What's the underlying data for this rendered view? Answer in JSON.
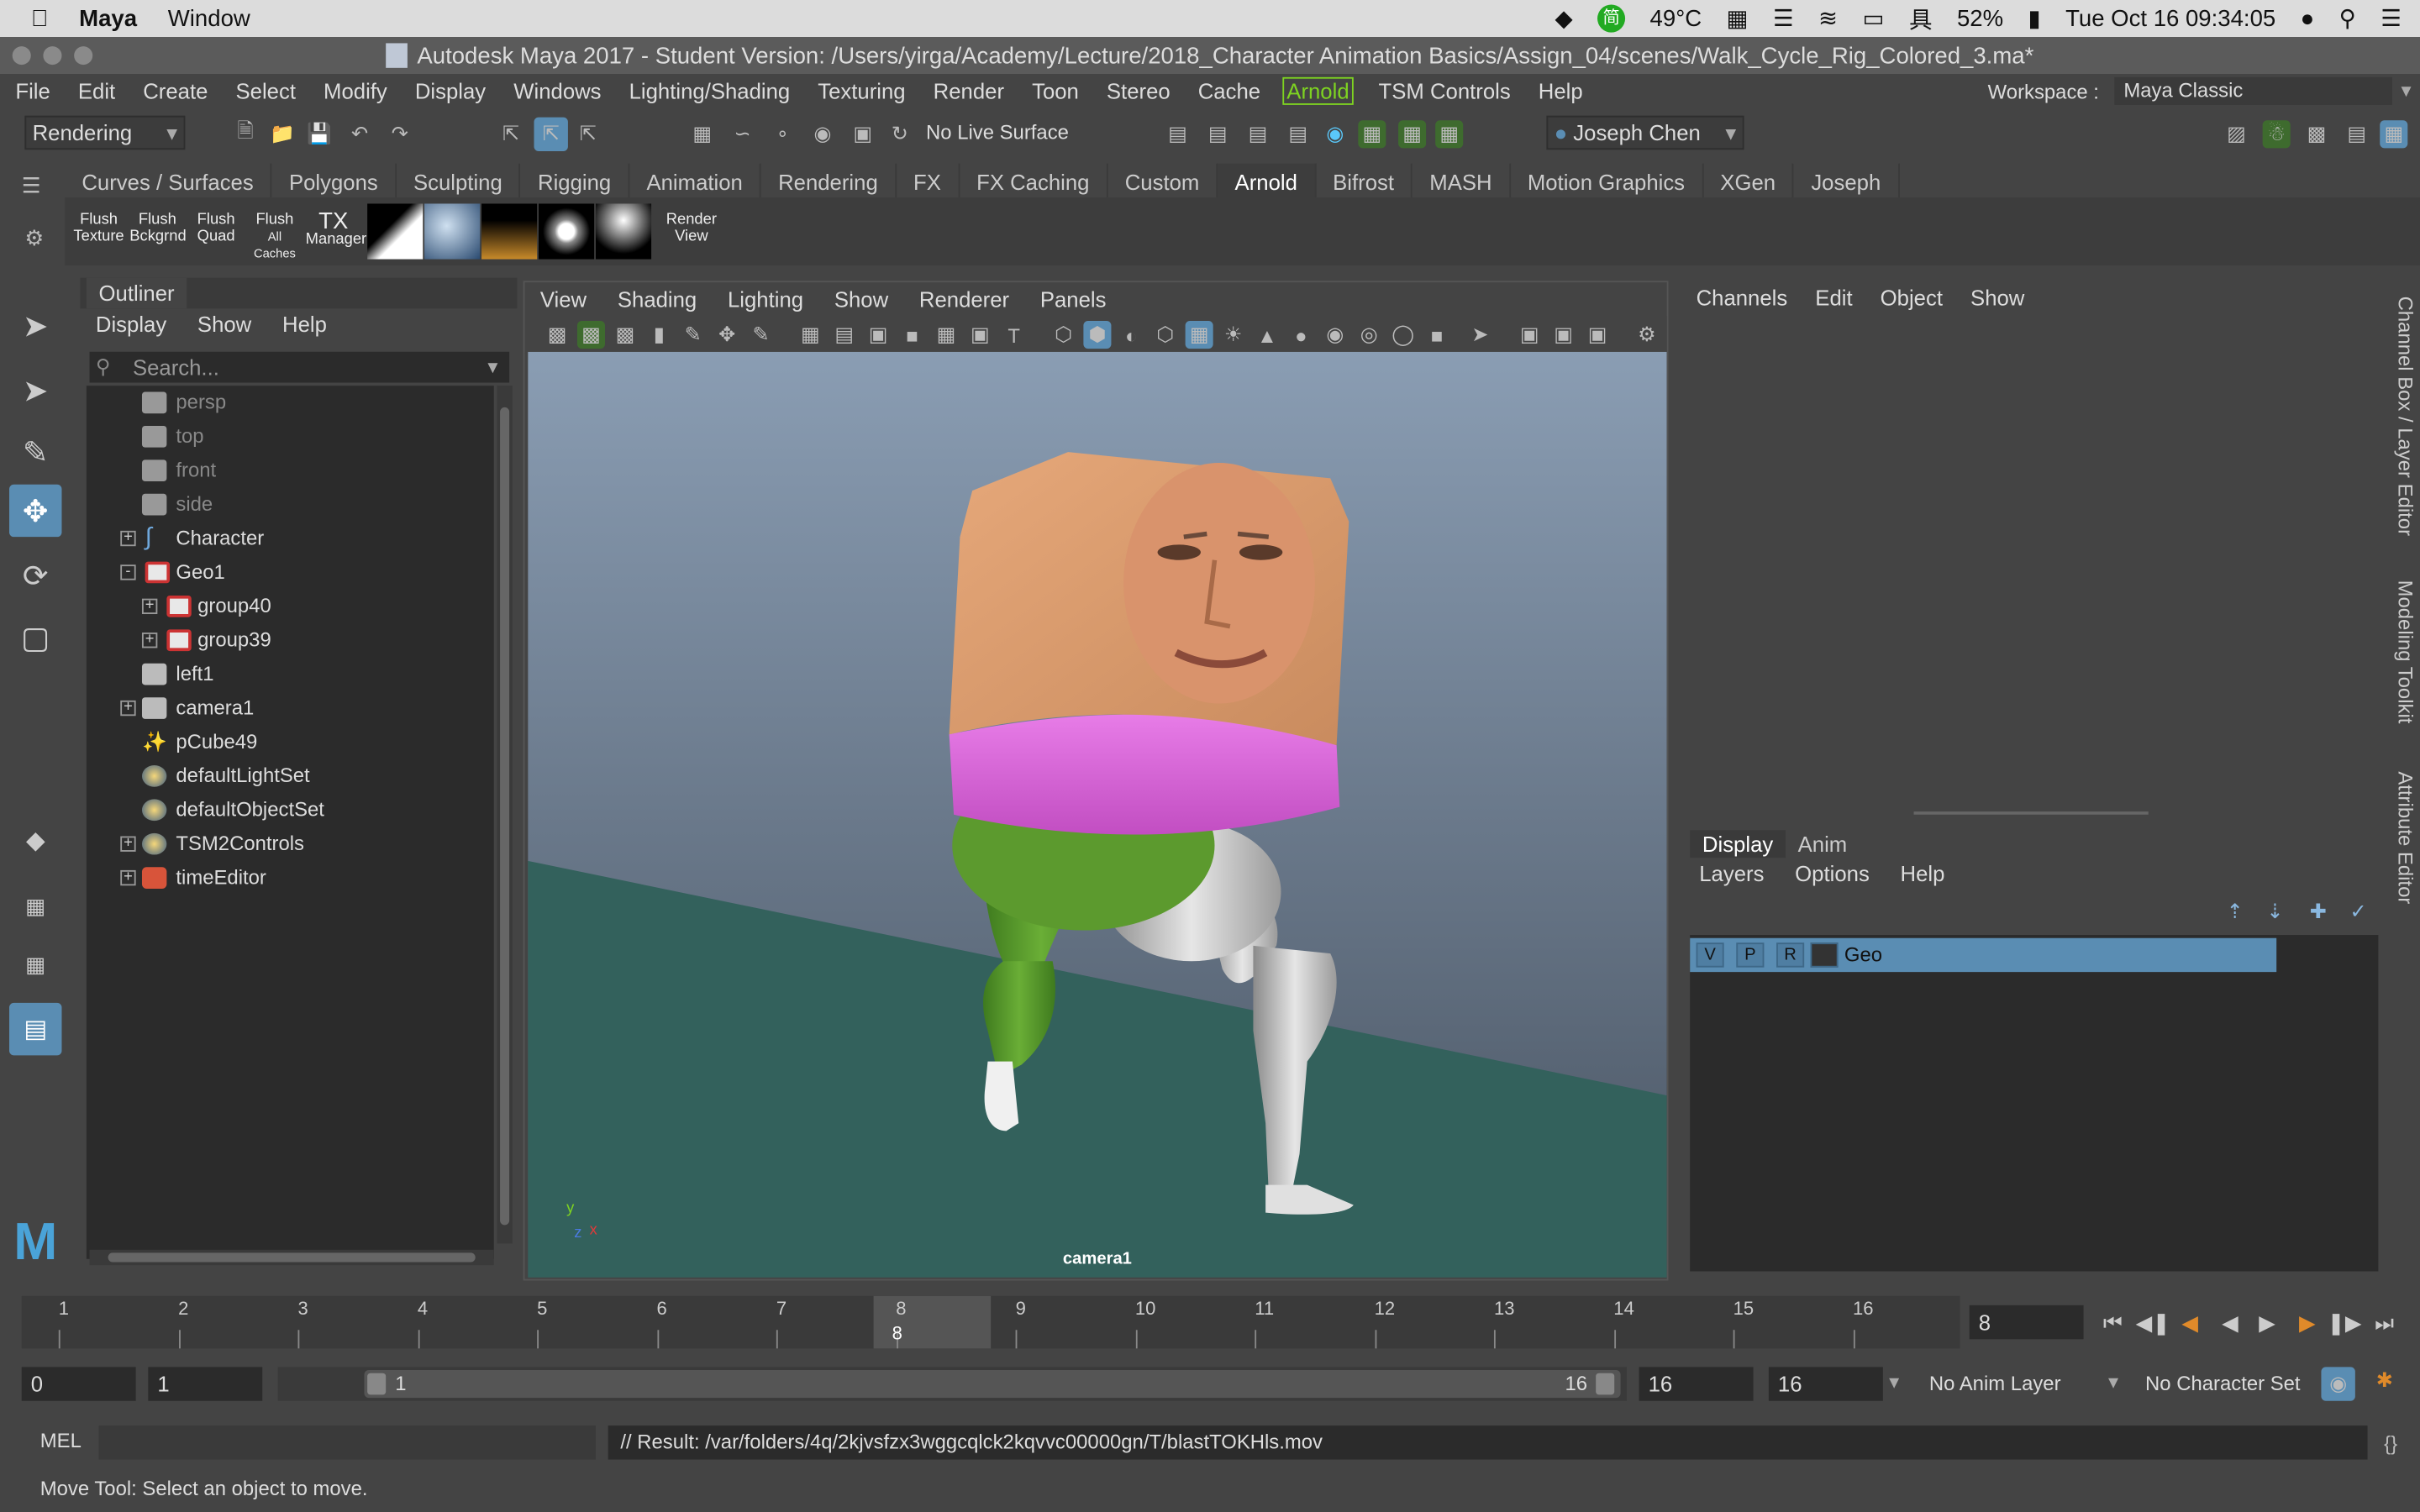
{
  "macbar": {
    "app_name": "Maya",
    "menu_window": "Window",
    "temperature": "49°C",
    "battery": "52%",
    "datetime": "Tue Oct 16  09:34:05"
  },
  "window": {
    "title": "Autodesk Maya 2017 - Student Version: /Users/yirga/Academy/Lecture/2018_Character Animation Basics/Assign_04/scenes/Walk_Cycle_Rig_Colored_3.ma*"
  },
  "menu": {
    "items": [
      "File",
      "Edit",
      "Create",
      "Select",
      "Modify",
      "Display",
      "Windows",
      "Lighting/Shading",
      "Texturing",
      "Render",
      "Toon",
      "Stereo",
      "Cache"
    ],
    "arnold": "Arnold",
    "tail": [
      "TSM Controls",
      "Help"
    ],
    "workspace_label": "Workspace :",
    "workspace_value": "Maya Classic"
  },
  "statusline": {
    "menuset": "Rendering",
    "live_surface": "No Live Surface",
    "user": "Joseph Chen"
  },
  "shelf": {
    "tabs": [
      "Curves / Surfaces",
      "Polygons",
      "Sculpting",
      "Rigging",
      "Animation",
      "Rendering",
      "FX",
      "FX Caching",
      "Custom",
      "Arnold",
      "Bifrost",
      "MASH",
      "Motion Graphics",
      "XGen",
      "Joseph"
    ],
    "active_tab": "Arnold",
    "buttons": [
      {
        "line1": "Flush",
        "line2": "Texture"
      },
      {
        "line1": "Flush",
        "line2": "Bckgrnd"
      },
      {
        "line1": "Flush",
        "line2": "Quad"
      },
      {
        "line1": "Flush",
        "line2": "All Caches"
      },
      {
        "line1": "TX",
        "line2": "Manager"
      }
    ],
    "render_view": {
      "line1": "Render",
      "line2": "View"
    }
  },
  "outliner": {
    "tab": "Outliner",
    "menu": [
      "Display",
      "Show",
      "Help"
    ],
    "search_placeholder": "Search...",
    "items": [
      {
        "label": "persp",
        "icon": "camera-icon",
        "dim": true,
        "indent": 1
      },
      {
        "label": "top",
        "icon": "camera-icon",
        "dim": true,
        "indent": 1
      },
      {
        "label": "front",
        "icon": "camera-icon",
        "dim": true,
        "indent": 1
      },
      {
        "label": "side",
        "icon": "camera-icon",
        "dim": true,
        "indent": 1
      },
      {
        "label": "Character",
        "icon": "curve-icon",
        "expand": "+",
        "indent": 1
      },
      {
        "label": "Geo1",
        "icon": "geo-group-icon",
        "expand": "-",
        "indent": 1
      },
      {
        "label": "group40",
        "icon": "geo-group-icon",
        "expand": "+",
        "indent": 2
      },
      {
        "label": "group39",
        "icon": "geo-group-icon",
        "expand": "+",
        "indent": 2
      },
      {
        "label": "left1",
        "icon": "camera-icon",
        "indent": 1
      },
      {
        "label": "camera1",
        "icon": "camera-icon",
        "expand": "+",
        "indent": 1
      },
      {
        "label": "pCube49",
        "icon": "mesh-icon",
        "indent": 1
      },
      {
        "label": "defaultLightSet",
        "icon": "set-icon",
        "indent": 1
      },
      {
        "label": "defaultObjectSet",
        "icon": "set-icon",
        "indent": 1
      },
      {
        "label": "TSM2Controls",
        "icon": "set-icon",
        "expand": "+",
        "indent": 1
      },
      {
        "label": "timeEditor",
        "icon": "clock-icon",
        "expand": "+",
        "indent": 1
      }
    ]
  },
  "viewport": {
    "menu": [
      "View",
      "Shading",
      "Lighting",
      "Show",
      "Renderer",
      "Panels"
    ],
    "camera_label": "camera1",
    "axis_x": "x",
    "axis_y": "y",
    "axis_z": "z"
  },
  "channelbox": {
    "menu": [
      "Channels",
      "Edit",
      "Object",
      "Show"
    ]
  },
  "layer_editor": {
    "tabs": [
      "Display",
      "Anim"
    ],
    "active_tab": "Display",
    "menu": [
      "Layers",
      "Options",
      "Help"
    ],
    "layer": {
      "v": "V",
      "p": "P",
      "r": "R",
      "name": "Geo"
    }
  },
  "side_tabs": [
    "Channel Box / Layer Editor",
    "Modeling Toolkit",
    "Attribute Editor"
  ],
  "timeline": {
    "ticks": [
      "1",
      "2",
      "3",
      "4",
      "5",
      "6",
      "7",
      "8",
      "9",
      "10",
      "11",
      "12",
      "13",
      "14",
      "15",
      "16"
    ],
    "current_frame": "8",
    "current_frame_field": "8"
  },
  "range": {
    "start": "0",
    "playback_start": "1",
    "slider_start": "1",
    "slider_end": "16",
    "playback_end": "16",
    "end": "16",
    "anim_layer": "No Anim Layer",
    "character_set": "No Character Set"
  },
  "command": {
    "mode": "MEL",
    "result": "// Result: /var/folders/4q/2kjvsfzx3wggcqlck2kqvvc00000gn/T/blastTOKHls.mov"
  },
  "helpline": "Move Tool: Select an object to move.",
  "colors": {
    "viewport_sky_top": "#8a9db3",
    "viewport_sky_bottom": "#4a5563",
    "ground": "#33615c",
    "belt": "#d65ad6",
    "left_leg": "#5c9a2e",
    "right_leg": "#c8c8c8",
    "head": "#e0a277",
    "layer_highlight": "#5a8db3",
    "arnold_green": "#7ed321"
  }
}
